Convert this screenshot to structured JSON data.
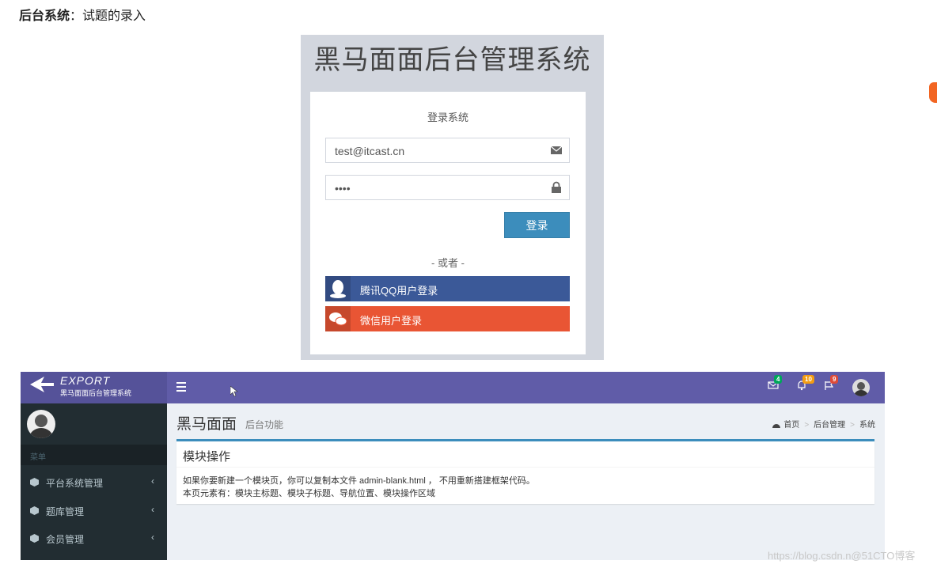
{
  "heading": {
    "bold": "后台系统",
    "rest": "：试题的录入"
  },
  "login": {
    "title": "黑马面面后台管理系统",
    "subtitle": "登录系统",
    "email_value": "test@itcast.cn",
    "password_value": "••••",
    "login_button": "登录",
    "or_text": "- 或者 -",
    "qq_button": "腾讯QQ用户登录",
    "wechat_button": "微信用户登录",
    "colors": {
      "bg": "#d2d6de",
      "button": "#3c8dbc",
      "qq": "#3b5998",
      "wechat": "#e95534"
    }
  },
  "admin": {
    "logo_title": "EXPORT",
    "logo_sub": "黑马面面后台管理系统",
    "badges": {
      "mail": "4",
      "alerts": "10",
      "flags": "9"
    },
    "menu_header": "菜单",
    "menu_items": [
      {
        "label": "平台系统管理"
      },
      {
        "label": "题库管理"
      },
      {
        "label": "会员管理"
      }
    ],
    "page_title": "黑马面面",
    "page_subtitle": "后台功能",
    "breadcrumb": [
      "首页",
      "后台管理",
      "系统"
    ],
    "box_title": "模块操作",
    "box_line1": "如果你要新建一个模块页，你可以复制本文件 admin-blank.html ， 不用重新搭建框架代码。",
    "box_line2": "本页元素有：模块主标题、模块子标题、导航位置、模块操作区域",
    "colors": {
      "topbar": "#605ca8",
      "logo": "#555299",
      "sidebar": "#222d32",
      "content": "#ecf0f5"
    }
  },
  "watermark": "https://blog.csdn.n@51CTO博客"
}
